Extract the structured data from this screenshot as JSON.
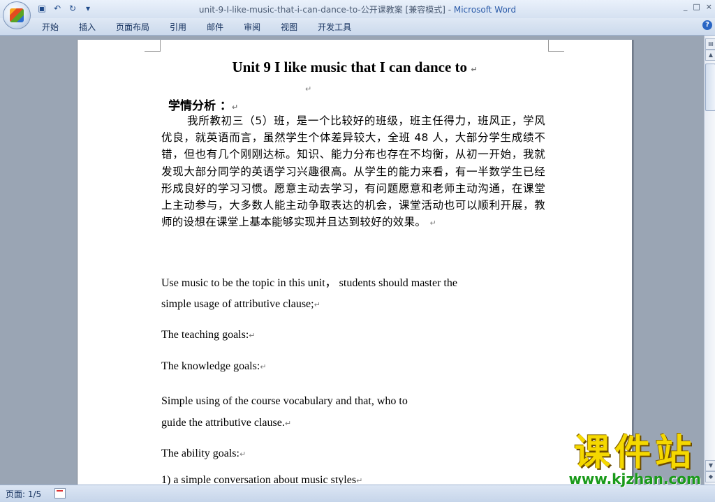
{
  "window": {
    "title_doc": "unit-9-I-like-music-that-i-can-dance-to-公开课教案 [兼容模式] - ",
    "title_app": "Microsoft Word",
    "controls": [
      "_",
      "□",
      "×"
    ]
  },
  "quick_access": {
    "save_icon": "floppy-save-icon",
    "undo_icon": "undo-icon",
    "redo_icon": "redo-icon",
    "customize_icon": "customize-arrow-icon"
  },
  "ribbon": {
    "tabs": [
      "开始",
      "插入",
      "页面布局",
      "引用",
      "邮件",
      "审阅",
      "视图",
      "开发工具"
    ],
    "help": "?"
  },
  "document": {
    "title": "Unit 9 I like music that I can dance to",
    "section_head": "学情分析 ：",
    "paragraph": "我所教初三（5）班，是一个比较好的班级，班主任得力，班风正，学风优良，就英语而言，虽然学生个体差异较大，全班 48 人，大部分学生成绩不错，但也有几个刚刚达标。知识、能力分布也存在不均衡，从初一开始，我就发现大部分同学的英语学习兴趣很高。从学生的能力来看，有一半数学生已经形成良好的学习习惯。愿意主动去学习，有问题愿意和老师主动沟通，在课堂上主动参与，大多数人能主动争取表达的机会，课堂活动也可以顺利开展，教师的设想在课堂上基本能够实现并且达到较好的效果。",
    "lines": [
      "Use music to be the topic in this unit， students should master the",
      "simple usage of attributive clause;",
      "The teaching goals:",
      "The   knowledge goals:",
      "Simple using of the course  vocabulary and that, who   to",
      "guide the attributive clause.",
      "The   ability goals:",
      "1) a simple conversation about    music styles"
    ],
    "para_mark": "↵"
  },
  "statusbar": {
    "page": "页面: 1/5"
  },
  "watermark": {
    "cn": "课件站",
    "url": "www.kjzhan.com"
  }
}
